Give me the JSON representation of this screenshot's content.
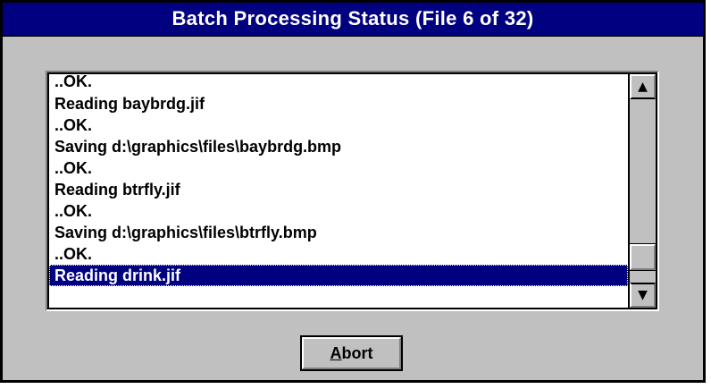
{
  "dialog": {
    "title": "Batch Processing Status (File 6 of 32)"
  },
  "log": {
    "lines": [
      "..OK.",
      "Reading baybrdg.jif",
      "..OK.",
      "Saving d:\\graphics\\files\\baybrdg.bmp",
      "..OK.",
      "Reading btrfly.jif",
      "..OK.",
      "Saving d:\\graphics\\files\\btrfly.bmp",
      "..OK.",
      "Reading drink.jif"
    ],
    "selected_index": 9,
    "scroll_position": 0.92
  },
  "scrollbar": {
    "up_icon": "up-arrow-icon",
    "down_icon": "down-arrow-icon"
  },
  "buttons": {
    "abort_mnemonic": "A",
    "abort_rest": "bort"
  },
  "colors": {
    "title_bar": "#000080",
    "dialog_face": "#c0c0c0",
    "selection": "#000080"
  }
}
